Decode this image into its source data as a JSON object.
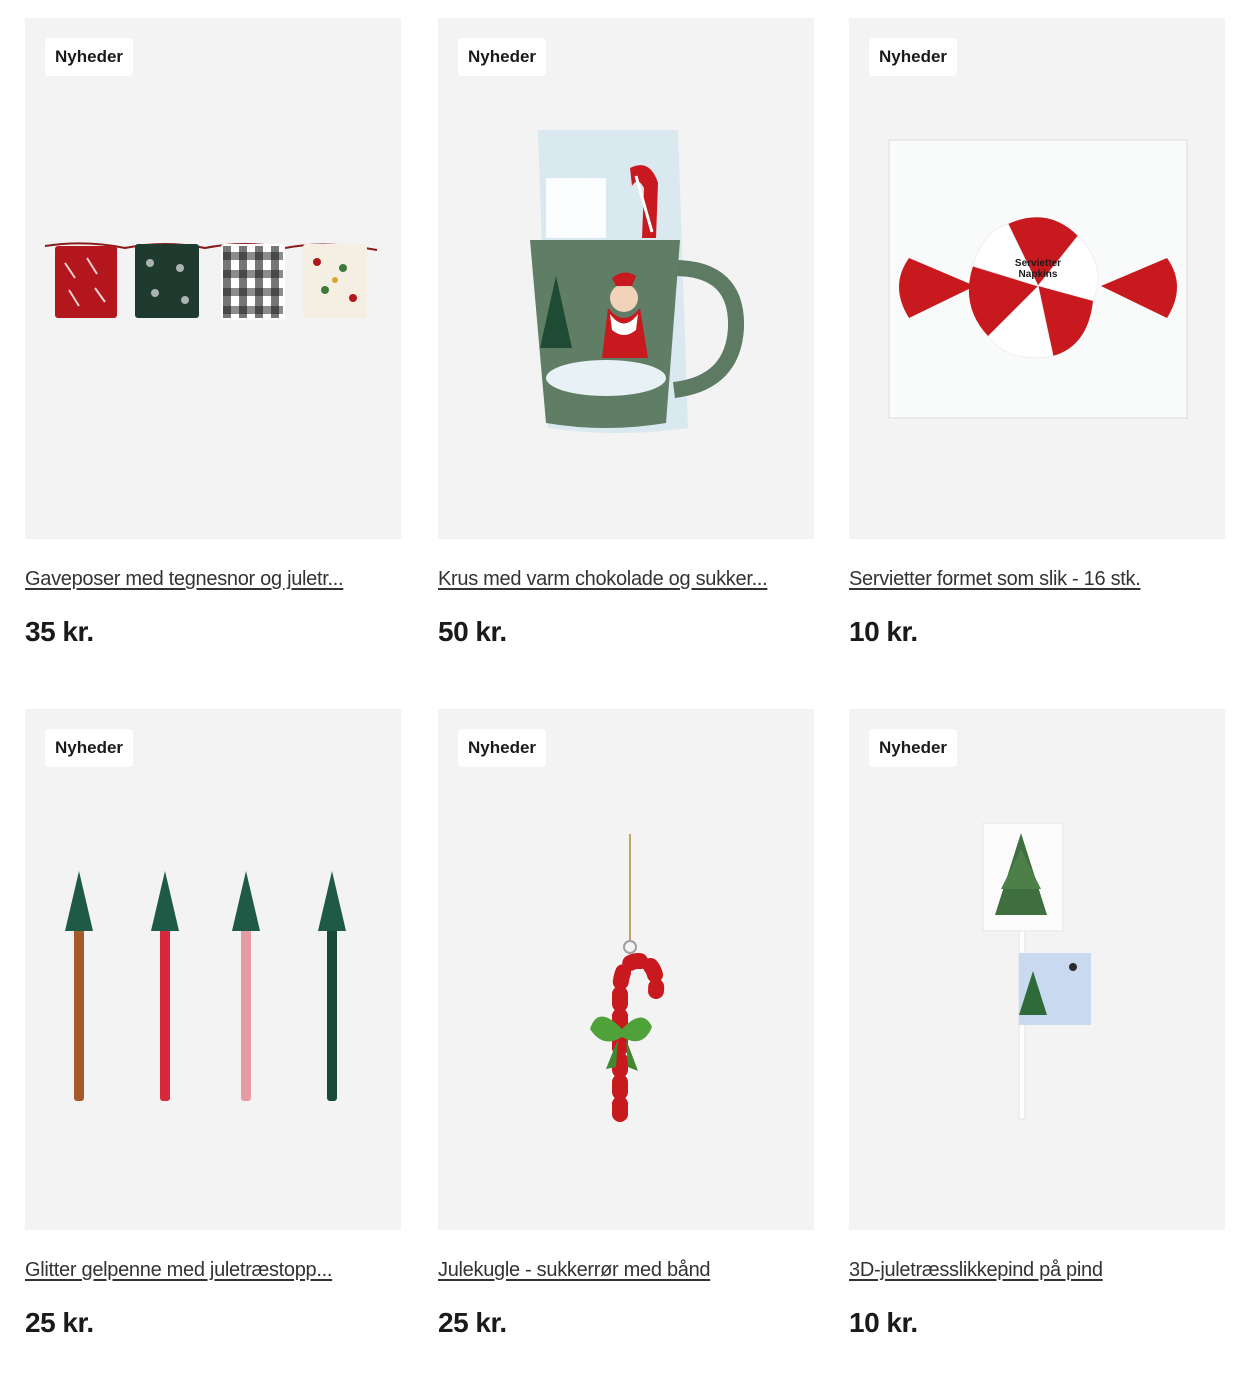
{
  "products": [
    {
      "badge": "Nyheder",
      "title": "Gaveposer med tegnesnor og juletr...",
      "price": "35 kr.",
      "image": "gift-bags-image"
    },
    {
      "badge": "Nyheder",
      "title": "Krus med varm chokolade og sukker...",
      "price": "50 kr.",
      "image": "mug-image"
    },
    {
      "badge": "Nyheder",
      "title": "Servietter formet som slik - 16 stk.",
      "price": "10 kr.",
      "image": "napkins-image",
      "image_text": {
        "line1": "Servietter",
        "line2": "Napkins"
      }
    },
    {
      "badge": "Nyheder",
      "title": "Glitter gelpenne med juletræstopp...",
      "price": "25 kr.",
      "image": "gel-pens-image"
    },
    {
      "badge": "Nyheder",
      "title": "Julekugle - sukkerrør med bånd",
      "price": "25 kr.",
      "image": "candy-cane-ornament-image"
    },
    {
      "badge": "Nyheder",
      "title": "3D-juletræsslikkepind på pind",
      "price": "10 kr.",
      "image": "tree-lollipop-image"
    }
  ],
  "colors": {
    "image_bg": "#f3f3f3",
    "badge_bg": "#ffffff",
    "text": "#1a1a1a",
    "red": "#c8191f",
    "green": "#2f5b45"
  }
}
